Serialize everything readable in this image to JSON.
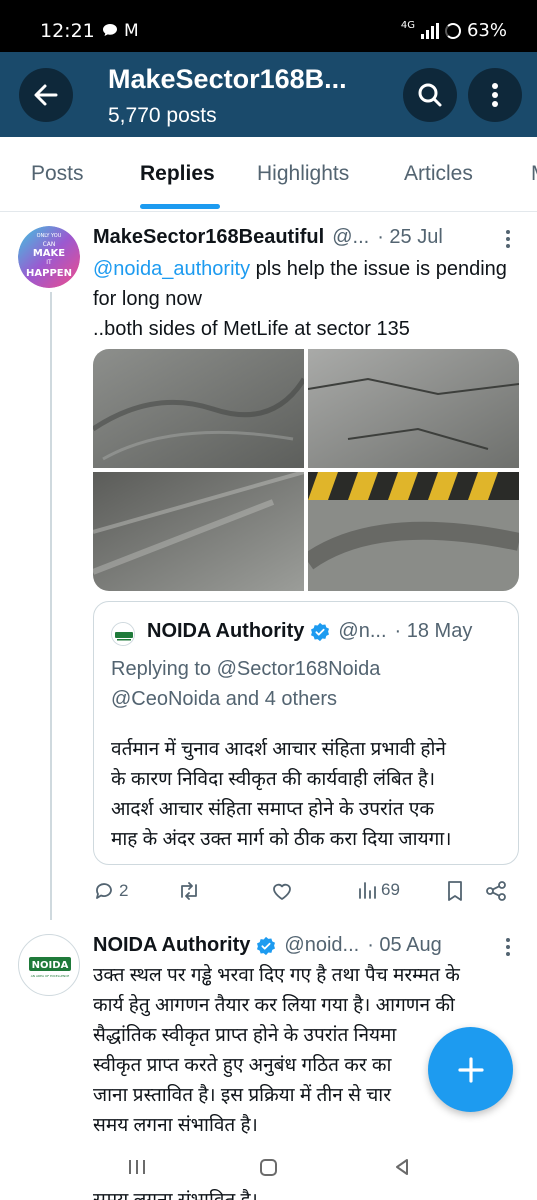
{
  "status_bar": {
    "time": "12:21",
    "mail_glyph": "M",
    "network": "4G",
    "battery": "63%"
  },
  "header": {
    "title": "MakeSector168B...",
    "posts_count": "5,770 posts",
    "background": "#1a4a6b",
    "back_icon": "back-arrow-icon",
    "search_icon": "search-icon",
    "more_icon": "more-vertical-icon"
  },
  "tabs": [
    {
      "label": "Posts",
      "active": false
    },
    {
      "label": "Replies",
      "active": true
    },
    {
      "label": "Highlights",
      "active": false
    },
    {
      "label": "Articles",
      "active": false
    },
    {
      "label": "M",
      "active": false
    }
  ],
  "accent_color": "#1d9bf0",
  "tweet1": {
    "name": "MakeSector168Beautiful",
    "handle": "@...",
    "date": "· 25 Jul",
    "mention": "@noida_authority",
    "text_after_mention": " pls help the issue is pending for long now",
    "line2": "..both sides of MetLife at sector 135",
    "avatar_text": {
      "top": "ONLY YOU",
      "line1": "CAN",
      "line2": "MAKE",
      "line3": "IT",
      "line4": "HAPPEN"
    },
    "quote": {
      "name": "NOIDA Authority",
      "handle": "@n...",
      "date": "· 18 May",
      "replying_prefix": "Replying to ",
      "replying_mention": "@Sector168Noida",
      "replying_line2_mention": "@CeoNoida",
      "replying_line2_rest": " and 4 others",
      "body": [
        "वर्तमान में चुनाव आदर्श आचार संहिता प्रभावी होने",
        "के कारण  निविदा स्वीकृत की कार्यवाही लंबित है।",
        "आदर्श आचार संहिता समाप्त होने के उपरांत एक",
        "माह के अंदर उक्त मार्ग को ठीक करा दिया जायगा।"
      ]
    },
    "actions": {
      "replies": "2",
      "reposts": "",
      "likes": "",
      "views": "69"
    }
  },
  "tweet2": {
    "name": "NOIDA Authority",
    "handle": "@noid...",
    "date": "· 05 Aug",
    "logo_caption": "AN AREA OF EXCELLENCE",
    "logo_text": "NOIDA",
    "body": [
      "उक्त स्थल पर गड्ढे भरवा दिए गए है तथा पैच मरम्मत के",
      "कार्य हेतु आगणन तैयार कर लिया गया है। आगणन की",
      "सैद्धांतिक स्वीकृत प्राप्त होने के उपरांत नियमा",
      "स्वीकृत प्राप्त करते हुए अनुबंध गठित कर का",
      "जाना प्रस्तावित है। इस प्रक्रिया में तीन से चार",
      "समय लगना संभावित है।"
    ],
    "peek_text": "समय लगना संभावित है।"
  },
  "fab_icon": "plus-icon",
  "nav": {
    "recents_icon": "recents-icon",
    "home_icon": "home-icon",
    "back_icon": "nav-back-icon"
  }
}
